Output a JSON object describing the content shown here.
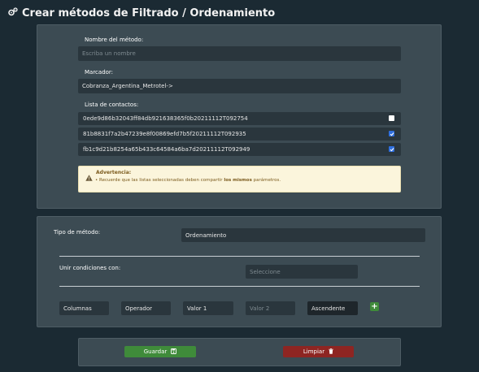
{
  "header": {
    "icon": "gears-icon",
    "title": "Crear métodos de Filtrado / Ordenamiento"
  },
  "method": {
    "name_label": "Nombre del método:",
    "name_placeholder": "Escriba un nombre",
    "marker_label": "Marcador:",
    "marker_value": "Cobranza_Argentina_Metrotel->",
    "contacts_label": "Lista de contactos:",
    "contacts": [
      {
        "id": "0ede9d86b32043ff84db921638365f0b20211112T092754",
        "checked": false
      },
      {
        "id": "81b8831f7a2b47239e8f00869efd7b5f20211112T092935",
        "checked": true
      },
      {
        "id": "fb1c9d21b8254a65b433c64584a6ba7d20211112T092949",
        "checked": true
      }
    ],
    "warning": {
      "icon": "warning-icon",
      "title": "Advertencia:",
      "text_before": "Recuerde que las listas seleccionadas deben compartir ",
      "text_bold": "los mismos",
      "text_after": " parámetros."
    }
  },
  "type_panel": {
    "type_label": "Tipo de método:",
    "type_value": "Ordenamiento",
    "union_label": "Unir condiciones con:",
    "union_placeholder": "Seleccione",
    "condition": {
      "column": "Columnas",
      "operator": "Operador",
      "value1": "Valor 1",
      "value2": "Valor 2",
      "order": "Ascendente"
    },
    "add_icon": "plus-icon",
    "add_label": "+"
  },
  "actions": {
    "save_label": "Guardar",
    "save_icon": "floppy-disk-icon",
    "clear_label": "Limpiar",
    "clear_icon": "trash-icon"
  }
}
